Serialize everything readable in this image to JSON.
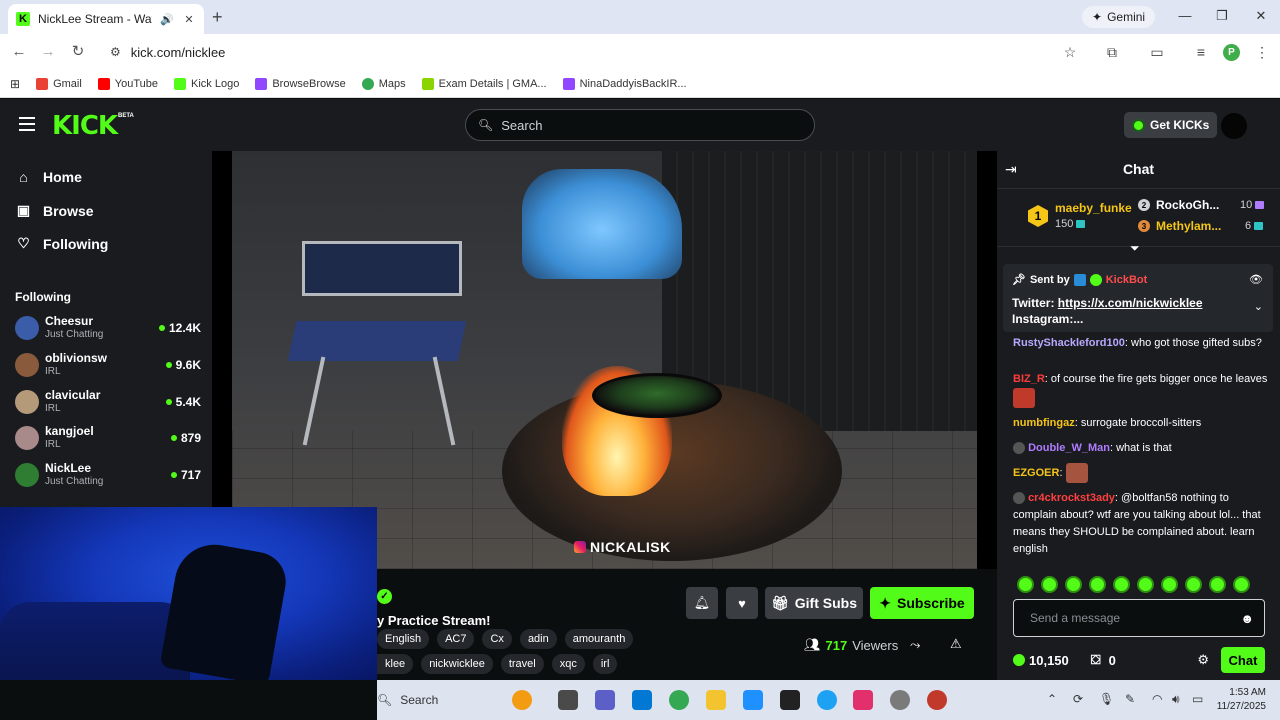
{
  "browser": {
    "tab_title": "NickLee Stream - Watch Live",
    "new_tab": "+",
    "gemini_label": "Gemini",
    "url": "kick.com/nicklee",
    "profile_initial": "P",
    "bookmarks": [
      {
        "label": "Gmail",
        "color": "#ea4335"
      },
      {
        "label": "YouTube",
        "color": "#ff0000"
      },
      {
        "label": "Kick Logo",
        "color": "#53fc18"
      },
      {
        "label": "BrowseBrowse",
        "color": "#9146ff"
      },
      {
        "label": "Maps",
        "color": "#34a853"
      },
      {
        "label": "Exam Details | GMA...",
        "color": "#8bd400"
      },
      {
        "label": "NinaDaddyisBackIR...",
        "color": "#9146ff"
      }
    ]
  },
  "kick": {
    "logo": "KICK",
    "logo_badge": "BETA",
    "search_placeholder": "Search",
    "get_kicks": "Get KICKs",
    "accent": "#53fc18"
  },
  "sidebar": {
    "nav": [
      {
        "label": "Home",
        "icon": "home-icon"
      },
      {
        "label": "Browse",
        "icon": "browse-icon"
      },
      {
        "label": "Following",
        "icon": "heart-icon"
      }
    ],
    "following_heading": "Following",
    "channels": [
      {
        "name": "Cheesur",
        "category": "Just Chatting",
        "viewers": "12.4K",
        "avatar_color": "#3b5ca8"
      },
      {
        "name": "oblivionsw",
        "category": "IRL",
        "viewers": "9.6K",
        "avatar_color": "#8a5a3c"
      },
      {
        "name": "clavicular",
        "category": "IRL",
        "viewers": "5.4K",
        "avatar_color": "#b59a7a"
      },
      {
        "name": "kangjoel",
        "category": "IRL",
        "viewers": "879",
        "avatar_color": "#a88a8a"
      },
      {
        "name": "NickLee",
        "category": "Just Chatting",
        "viewers": "717",
        "avatar_color": "#2e7d32"
      }
    ]
  },
  "video": {
    "watermark": "NICKALISK"
  },
  "stream": {
    "title": "y Practice Stream!",
    "tags_row1": [
      "English",
      "AC7",
      "Cx",
      "adin",
      "amouranth"
    ],
    "tags_row2": [
      "klee",
      "nickwicklee",
      "travel",
      "xqc",
      "irl"
    ],
    "gift_subs": "Gift Subs",
    "subscribe": "Subscribe",
    "viewers_count": "717",
    "viewers_label": "Viewers"
  },
  "chat": {
    "title": "Chat",
    "leaderboard": {
      "top": {
        "rank": "1",
        "name": "maeby_funke",
        "value": "150"
      },
      "second": {
        "name": "RockoGh...",
        "value": "10"
      },
      "third": {
        "name": "Methylam...",
        "value": "6"
      }
    },
    "pinned": {
      "sent_by": "Sent by",
      "sender": "KickBot",
      "line1_prefix": "Twitter: ",
      "line1_link": "https://x.com/nickwicklee",
      "line2": "Instagram:..."
    },
    "messages": [
      {
        "user": "RustyShackleford100",
        "color": "#b9a8ff",
        "text": "who got those gifted subs?"
      },
      {
        "user": "BIZ_R",
        "color": "#ff3b3b",
        "text": "of course the fire gets bigger once he leaves"
      },
      {
        "user": "numbfingaz",
        "color": "#f5c518",
        "text": "surrogate broccoll-sitters"
      },
      {
        "user": "Double_W_Man",
        "color": "#b07cff",
        "text": "what is that"
      },
      {
        "user": "EZGOER",
        "color": "#f5c518",
        "text": ""
      },
      {
        "user": "cr4ckrockst3ady",
        "color": "#ff4040",
        "text": "@boltfan58 nothing to complain about? wtf are you talking about lol... that means they SHOULD be complained about. learn english"
      }
    ],
    "input_placeholder": "Send a message",
    "kicks_balance": "10,150",
    "points": "0",
    "chat_button": "Chat"
  },
  "taskbar": {
    "search": "Search",
    "time": "1:53 AM",
    "date": "11/27/2025"
  }
}
